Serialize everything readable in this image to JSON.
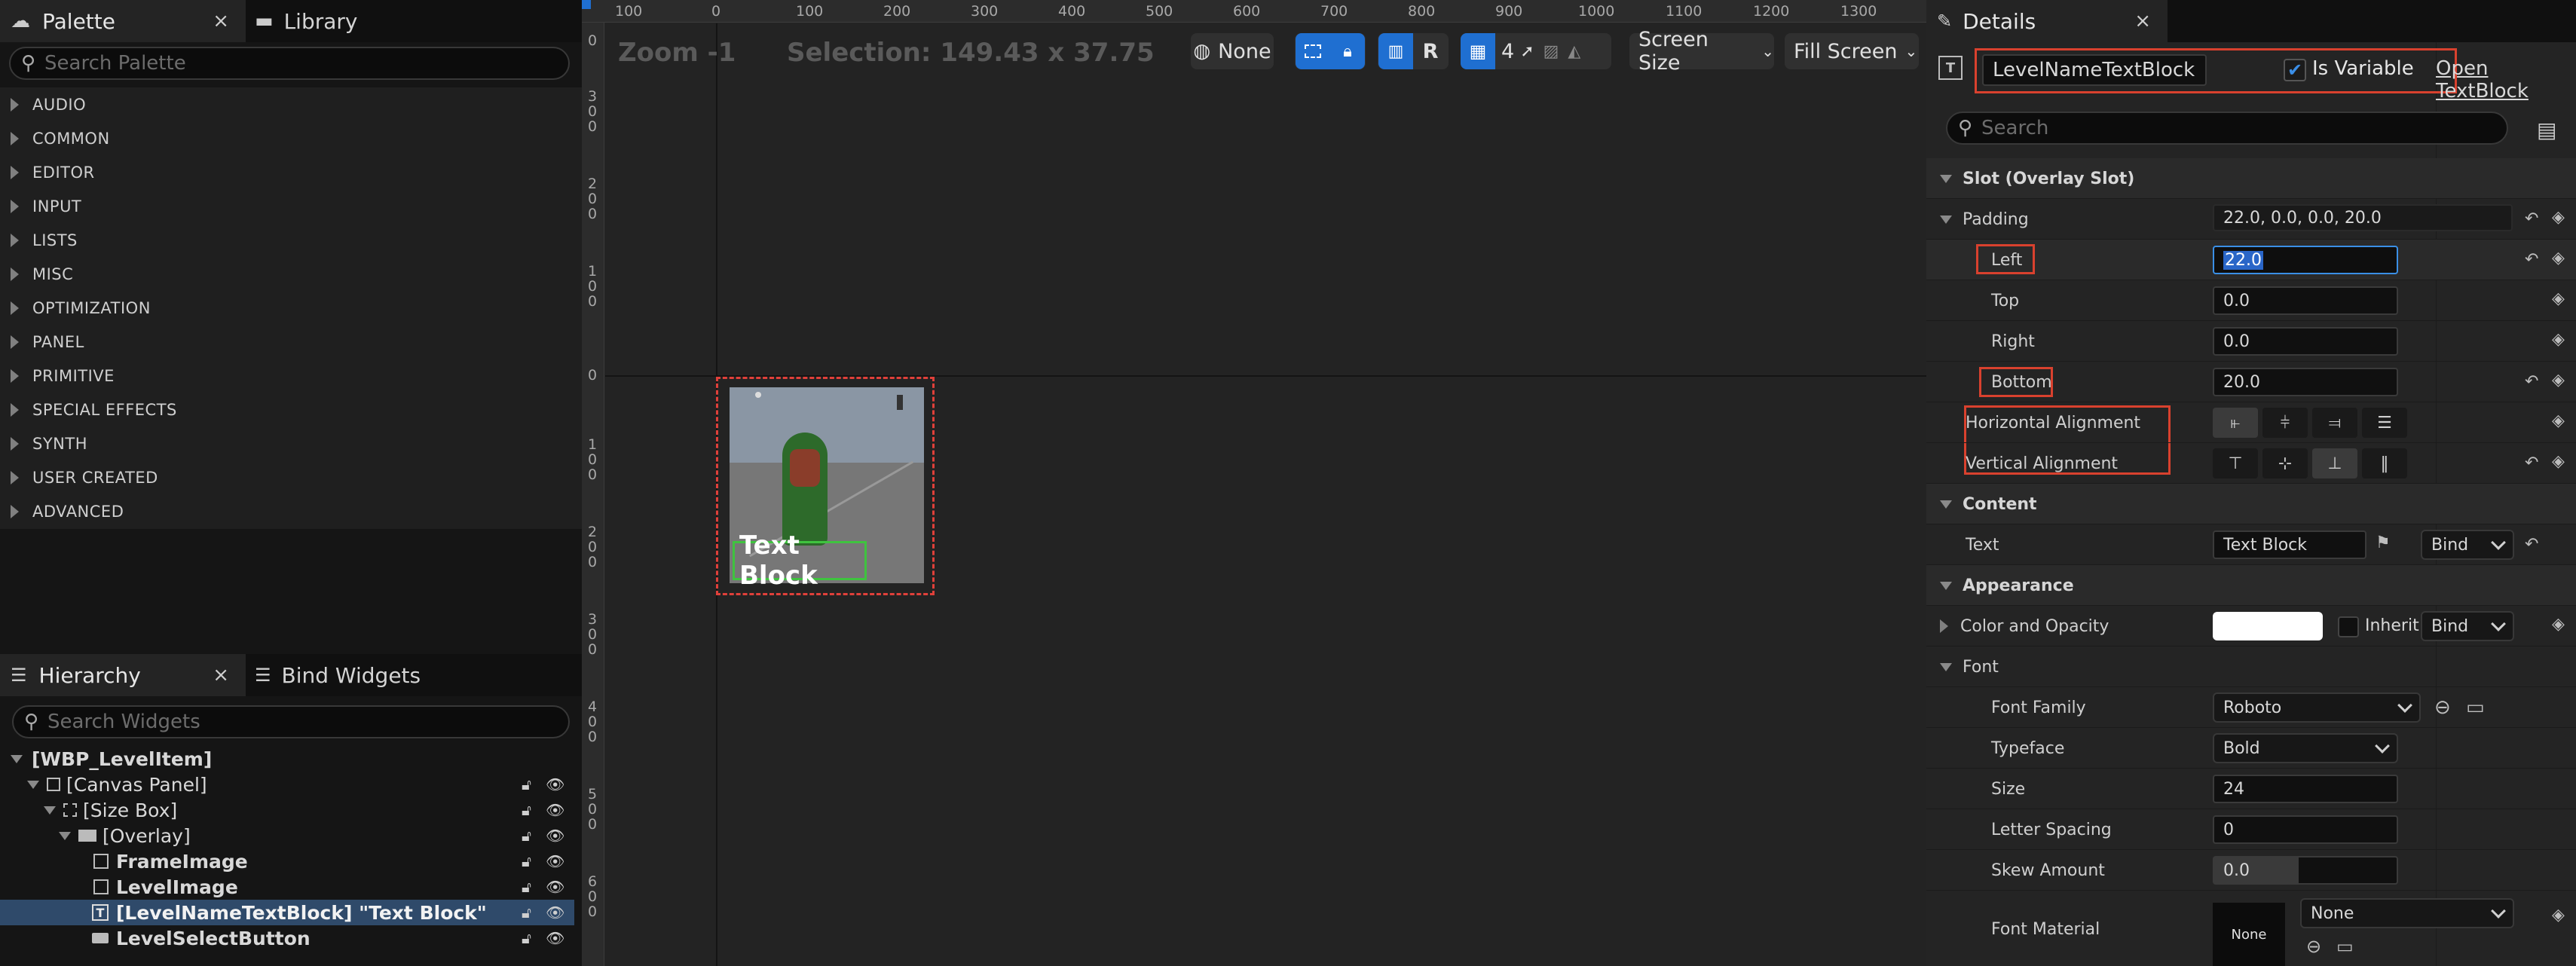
{
  "palette": {
    "tab_label": "Palette",
    "close": "×",
    "library_tab": "Library",
    "search_placeholder": "Search Palette",
    "categories": [
      "AUDIO",
      "COMMON",
      "EDITOR",
      "INPUT",
      "LISTS",
      "MISC",
      "OPTIMIZATION",
      "PANEL",
      "PRIMITIVE",
      "SPECIAL EFFECTS",
      "SYNTH",
      "USER CREATED",
      "ADVANCED"
    ]
  },
  "hierarchy": {
    "tab_label": "Hierarchy",
    "close": "×",
    "bind_widgets_tab": "Bind Widgets",
    "search_placeholder": "Search Widgets",
    "items": [
      {
        "label": "[WBP_LevelItem]"
      },
      {
        "label": "[Canvas Panel]"
      },
      {
        "label": "[Size Box]"
      },
      {
        "label": "[Overlay]"
      },
      {
        "label": "FrameImage"
      },
      {
        "label": "LevelImage"
      },
      {
        "label": "[LevelNameTextBlock] \"Text Block\""
      },
      {
        "label": "LevelSelectButton"
      }
    ]
  },
  "viewport": {
    "zoom": "Zoom -1",
    "selection": "Selection: 149.43 x 37.75",
    "none_label": "None",
    "r_label": "R",
    "grid_count": "4",
    "screen_size": "Screen Size",
    "fill_screen": "Fill Screen",
    "widget_text": "Text Block",
    "ruler_top": [
      "100",
      "0",
      "100",
      "200",
      "300",
      "400",
      "500",
      "600",
      "700",
      "800",
      "900",
      "1000",
      "1100",
      "1200",
      "1300"
    ],
    "ruler_left": [
      "0",
      "3\n0\n0",
      "2\n0\n0",
      "1\n0\n0",
      "0",
      "1\n0\n0",
      "2\n0\n0",
      "3\n0\n0",
      "4\n0\n0",
      "5\n0\n0",
      "6\n0\n0"
    ]
  },
  "details": {
    "tab_label": "Details",
    "close": "×",
    "name_value": "LevelNameTextBlock",
    "is_variable": "Is Variable",
    "open_link": "Open TextBlock",
    "search_placeholder": "Search",
    "slot_section": "Slot (Overlay Slot)",
    "padding_label": "Padding",
    "padding_value": "22.0, 0.0, 0.0, 20.0",
    "left_label": "Left",
    "left_value": "22.0",
    "top_label": "Top",
    "top_value": "0.0",
    "right_label": "Right",
    "right_value": "0.0",
    "bottom_label": "Bottom",
    "bottom_value": "20.0",
    "halign_label": "Horizontal Alignment",
    "valign_label": "Vertical Alignment",
    "content_section": "Content",
    "text_label": "Text",
    "text_value": "Text Block",
    "bind": "Bind",
    "appearance_section": "Appearance",
    "color_label": "Color and Opacity",
    "inherit": "Inherit",
    "font_section": "Font",
    "font_family_label": "Font Family",
    "font_family_value": "Roboto",
    "typeface_label": "Typeface",
    "typeface_value": "Bold",
    "size_label": "Size",
    "size_value": "24",
    "letter_spacing_label": "Letter Spacing",
    "letter_spacing_value": "0",
    "skew_label": "Skew Amount",
    "skew_value": "0.0",
    "font_material_label": "Font Material",
    "font_material_thumb": "None",
    "font_material_value": "None"
  },
  "colors": {
    "accent_blue": "#1f6fd1",
    "highlight_red": "#d9412e",
    "selection_row": "#2f4a6a"
  }
}
